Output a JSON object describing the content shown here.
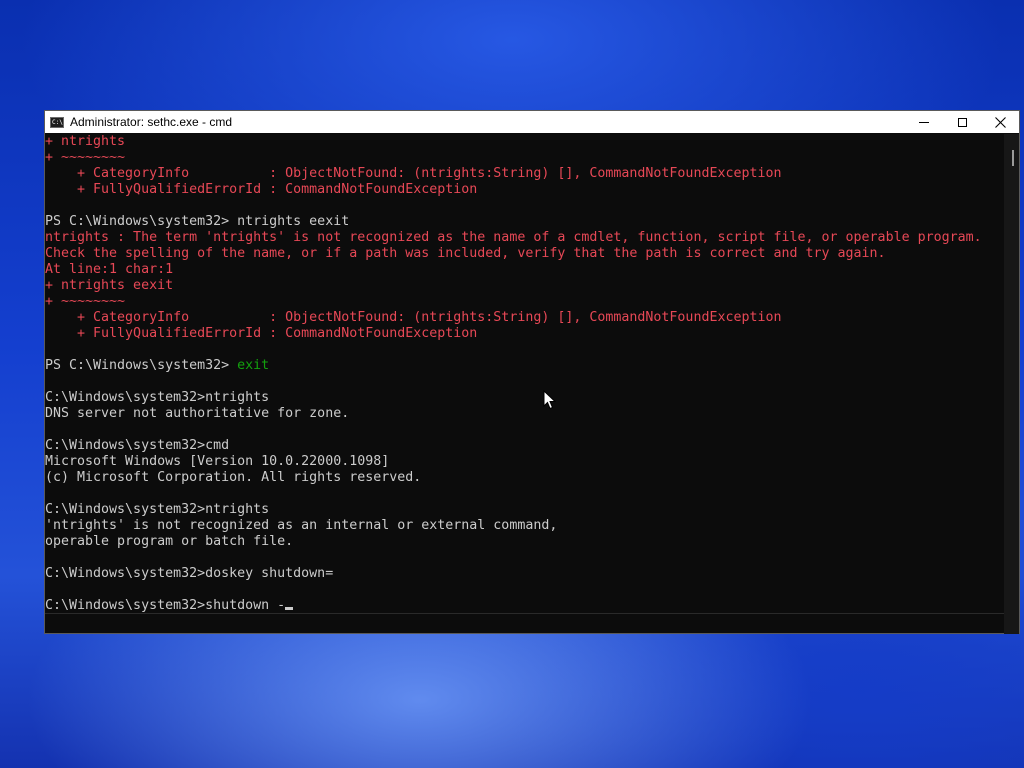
{
  "window": {
    "title": "Administrator: sethc.exe - cmd",
    "icon": "cmd-console-icon",
    "icon_text": "C:\\",
    "buttons": {
      "minimize": "minimize-icon",
      "maximize": "maximize-icon",
      "close": "close-icon"
    }
  },
  "colors": {
    "error": "#e74856",
    "command": "#13a10e",
    "text": "#cccccc",
    "background": "#0c0c0c"
  },
  "console": {
    "lines": [
      {
        "text": "+ ntrights",
        "style": "err"
      },
      {
        "text": "+ ~~~~~~~~",
        "style": "err"
      },
      {
        "text": "    + CategoryInfo          : ObjectNotFound: (ntrights:String) [], CommandNotFoundException",
        "style": "err"
      },
      {
        "text": "    + FullyQualifiedErrorId : CommandNotFoundException",
        "style": "err"
      },
      {
        "text": "",
        "style": "normal"
      },
      {
        "text": "PS C:\\Windows\\system32> ntrights eexit",
        "style": "normal"
      },
      {
        "text": "ntrights : The term 'ntrights' is not recognized as the name of a cmdlet, function, script file, or operable program.",
        "style": "err"
      },
      {
        "text": "Check the spelling of the name, or if a path was included, verify that the path is correct and try again.",
        "style": "err"
      },
      {
        "text": "At line:1 char:1",
        "style": "err"
      },
      {
        "text": "+ ntrights eexit",
        "style": "err"
      },
      {
        "text": "+ ~~~~~~~~",
        "style": "err"
      },
      {
        "text": "    + CategoryInfo          : ObjectNotFound: (ntrights:String) [], CommandNotFoundException",
        "style": "err"
      },
      {
        "text": "    + FullyQualifiedErrorId : CommandNotFoundException",
        "style": "err"
      },
      {
        "text": "",
        "style": "normal"
      },
      {
        "prompt": "PS C:\\Windows\\system32> ",
        "command": "exit",
        "style": "prompt-green"
      },
      {
        "text": "",
        "style": "normal"
      },
      {
        "text": "C:\\Windows\\system32>ntrights",
        "style": "normal"
      },
      {
        "text": "DNS server not authoritative for zone.",
        "style": "normal"
      },
      {
        "text": "",
        "style": "normal"
      },
      {
        "text": "C:\\Windows\\system32>cmd",
        "style": "normal"
      },
      {
        "text": "Microsoft Windows [Version 10.0.22000.1098]",
        "style": "normal"
      },
      {
        "text": "(c) Microsoft Corporation. All rights reserved.",
        "style": "normal"
      },
      {
        "text": "",
        "style": "normal"
      },
      {
        "text": "C:\\Windows\\system32>ntrights",
        "style": "normal"
      },
      {
        "text": "'ntrights' is not recognized as an internal or external command,",
        "style": "normal"
      },
      {
        "text": "operable program or batch file.",
        "style": "normal"
      },
      {
        "text": "",
        "style": "normal"
      },
      {
        "text": "C:\\Windows\\system32>doskey shutdown=",
        "style": "normal"
      },
      {
        "text": "",
        "style": "normal"
      },
      {
        "text": "C:\\Windows\\system32>shutdown -",
        "style": "cursor"
      }
    ]
  }
}
